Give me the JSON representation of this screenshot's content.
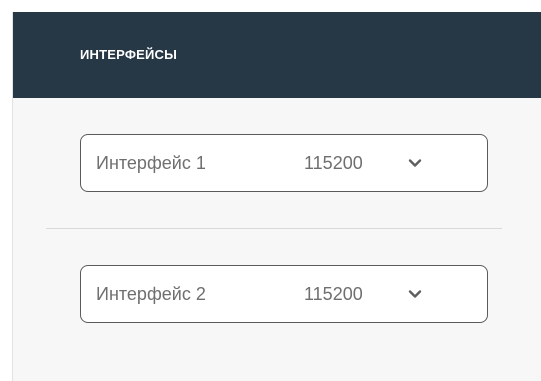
{
  "panel": {
    "title": "ИНТЕРФЕЙСЫ",
    "header_color": "#263846"
  },
  "interfaces": [
    {
      "label": "Интерфейс 1",
      "value": "115200",
      "icon": "chevron-down-icon"
    },
    {
      "label": "Интерфейс 2",
      "value": "115200",
      "icon": "chevron-down-icon"
    }
  ]
}
